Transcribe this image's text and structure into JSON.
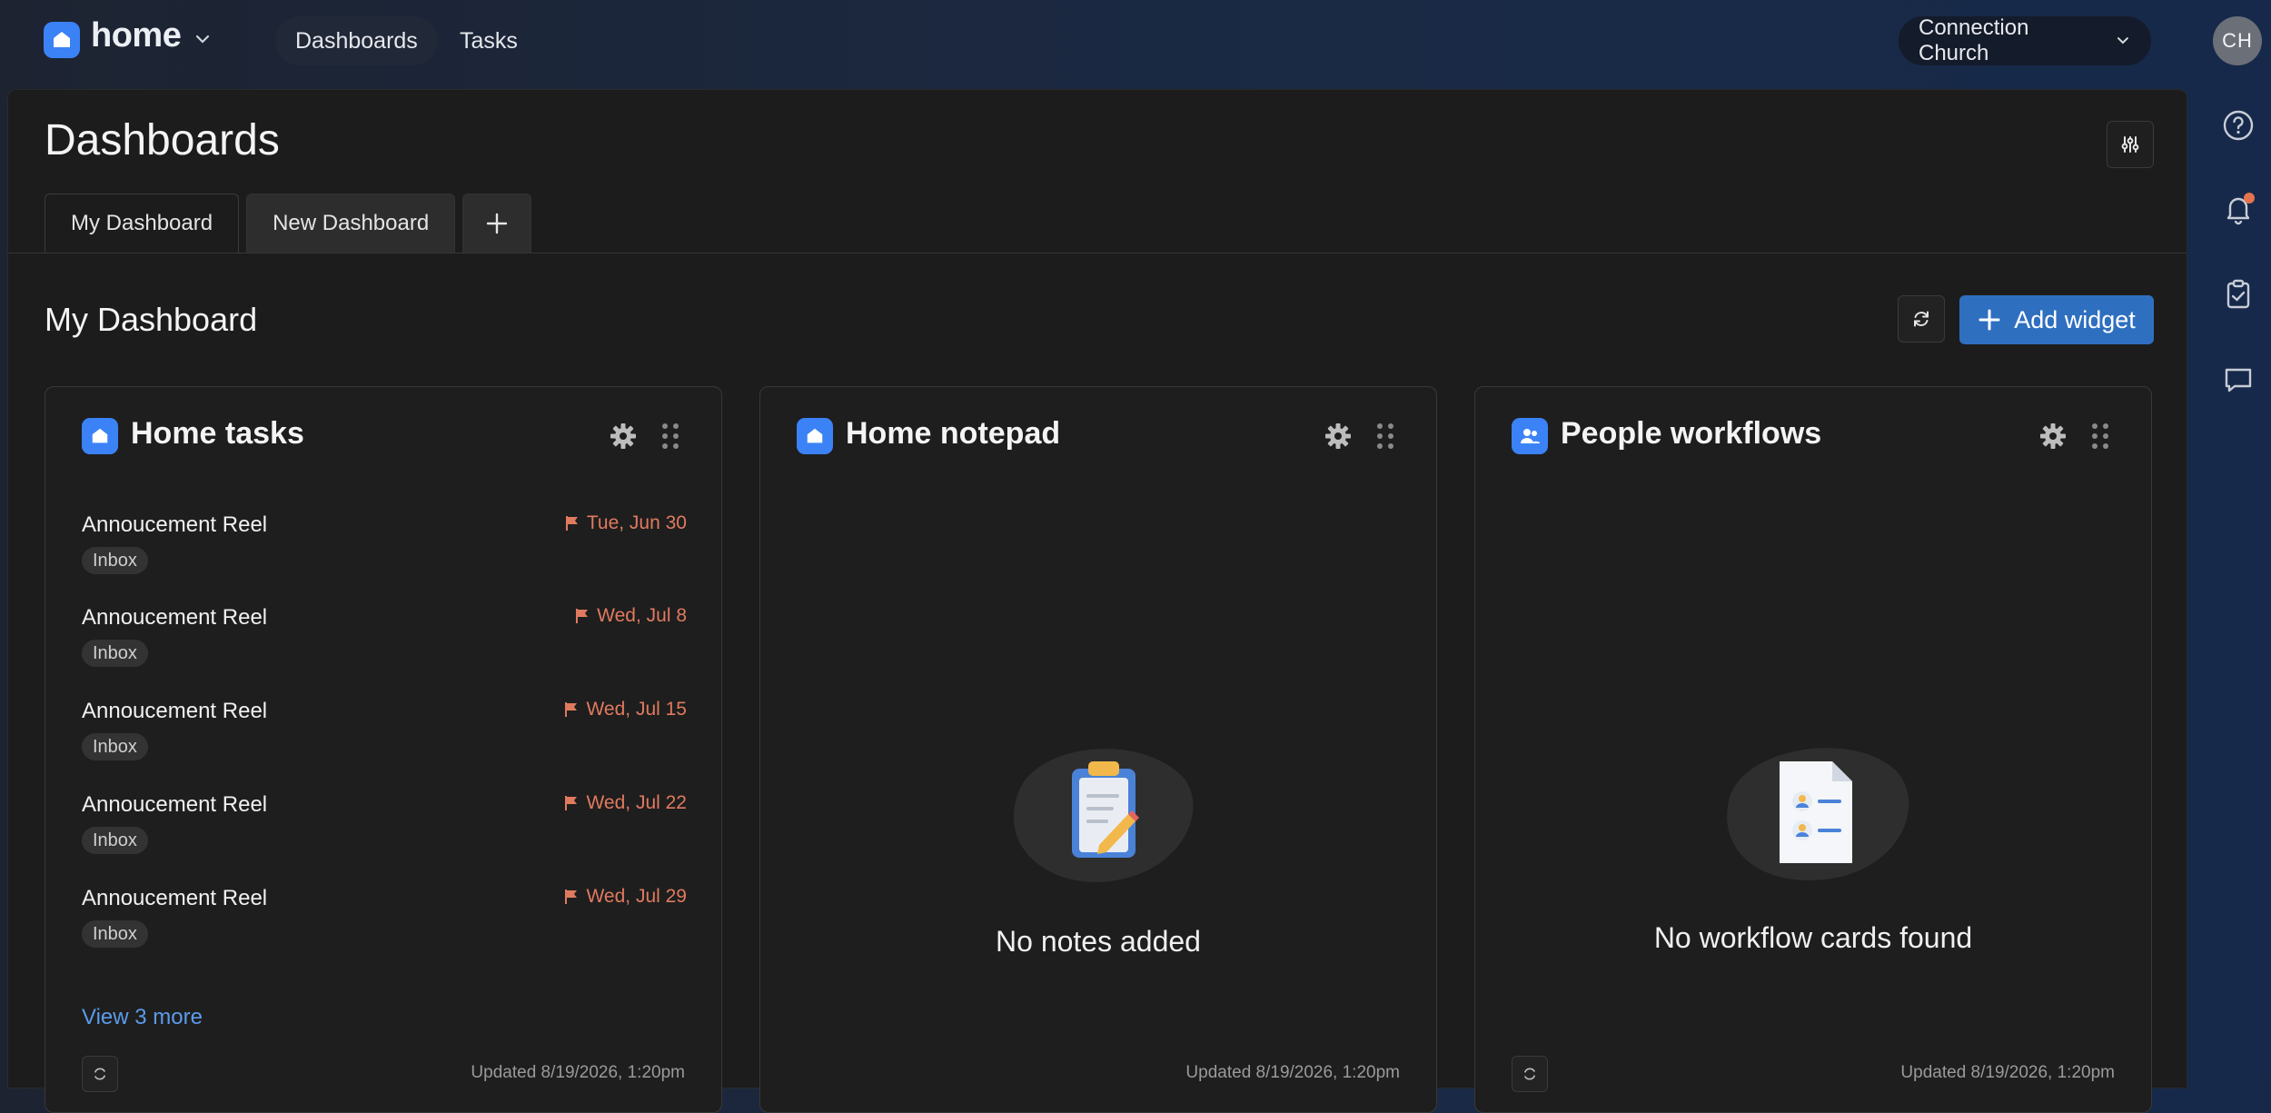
{
  "app": {
    "name": "home"
  },
  "nav": {
    "dashboards": "Dashboards",
    "tasks": "Tasks"
  },
  "org": {
    "selected": "Connection Church"
  },
  "user": {
    "initials": "CH"
  },
  "page": {
    "title": "Dashboards"
  },
  "tabs": [
    {
      "label": "My Dashboard",
      "active": true
    },
    {
      "label": "New Dashboard",
      "active": false
    },
    {
      "label": "+"
    }
  ],
  "dashboard": {
    "title": "My Dashboard",
    "add_widget_label": "Add widget"
  },
  "widgets": {
    "tasks": {
      "title": "Home tasks",
      "items": [
        {
          "title": "Annoucement Reel",
          "tag": "Inbox",
          "due": "Tue, Jun 30"
        },
        {
          "title": "Annoucement Reel",
          "tag": "Inbox",
          "due": "Wed, Jul 8"
        },
        {
          "title": "Annoucement Reel",
          "tag": "Inbox",
          "due": "Wed, Jul 15"
        },
        {
          "title": "Annoucement Reel",
          "tag": "Inbox",
          "due": "Wed, Jul 22"
        },
        {
          "title": "Annoucement Reel",
          "tag": "Inbox",
          "due": "Wed, Jul 29"
        }
      ],
      "view_more": "View 3 more",
      "updated": "Updated 8/19/2026, 1:20pm"
    },
    "notepad": {
      "title": "Home notepad",
      "empty": "No notes added",
      "updated": "Updated 8/19/2026, 1:20pm"
    },
    "workflows": {
      "title": "People workflows",
      "empty": "No workflow cards found",
      "updated": "Updated 8/19/2026, 1:20pm"
    }
  },
  "colors": {
    "accent": "#3b82f6",
    "primary_button": "#2f6fc0",
    "due_date": "#e07a5f",
    "link": "#5b9bea",
    "notification": "#e6734f"
  },
  "icons": [
    "home-icon",
    "chevron-down-icon",
    "help-icon",
    "bell-icon",
    "clipboard-check-icon",
    "chat-icon",
    "sliders-icon",
    "refresh-icon",
    "plus-icon",
    "gear-icon",
    "drag-handle-icon",
    "flag-icon",
    "people-icon"
  ]
}
